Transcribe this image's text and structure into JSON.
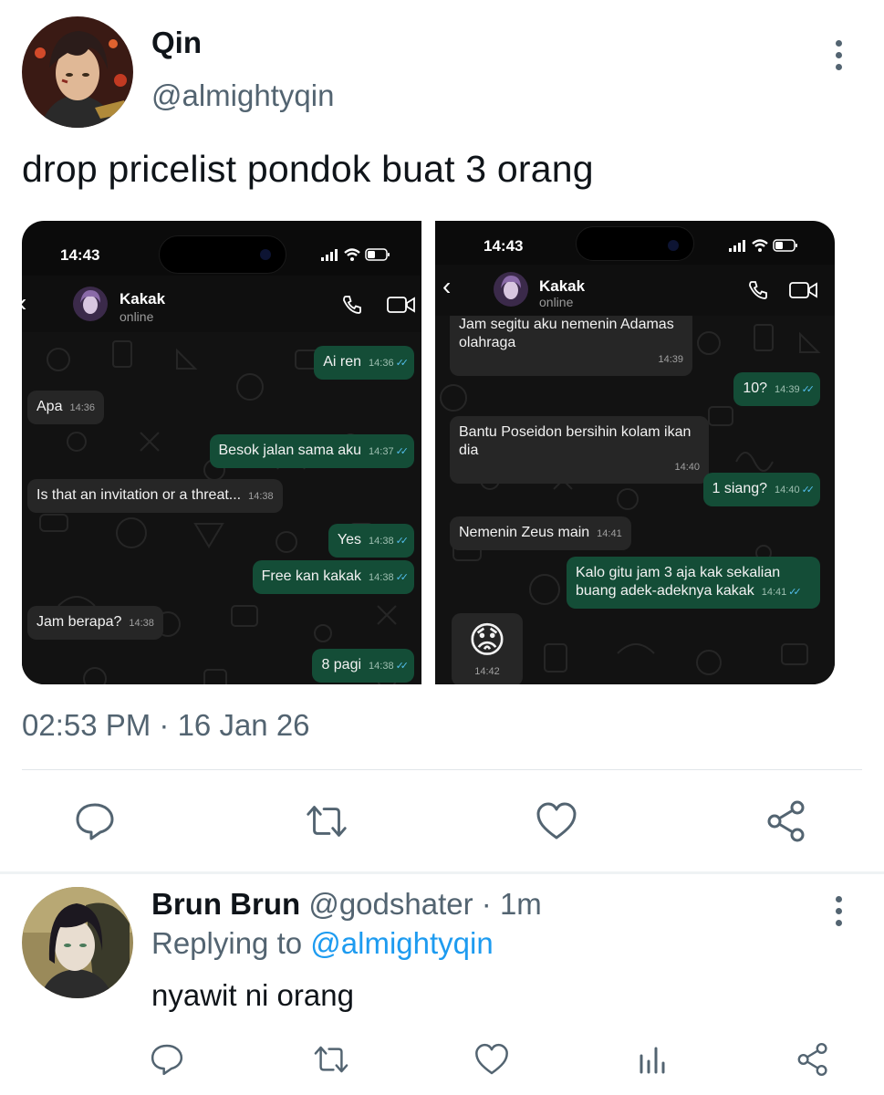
{
  "tweet": {
    "author_name": "Qin",
    "author_handle": "@almightyqin",
    "text": "drop pricelist pondok buat 3 orang",
    "timestamp": "02:53 PM · 16 Jan 26"
  },
  "screenshot_left": {
    "status_time": "14:43",
    "contact_name": "Kakak",
    "contact_status": "online",
    "messages": [
      {
        "dir": "out",
        "text": "Ai ren",
        "time": "14:36"
      },
      {
        "dir": "in",
        "text": "Apa",
        "time": "14:36"
      },
      {
        "dir": "out",
        "text": "Besok jalan sama aku",
        "time": "14:37"
      },
      {
        "dir": "in",
        "text": "Is that an invitation or a threat...",
        "time": "14:38"
      },
      {
        "dir": "out",
        "text": "Yes",
        "time": "14:38"
      },
      {
        "dir": "out",
        "text": "Free kan kakak",
        "time": "14:38"
      },
      {
        "dir": "in",
        "text": "Jam berapa?",
        "time": "14:38"
      },
      {
        "dir": "out",
        "text": "8 pagi",
        "time": "14:38"
      }
    ]
  },
  "screenshot_right": {
    "status_time": "14:43",
    "contact_name": "Kakak",
    "contact_status": "online",
    "messages": [
      {
        "dir": "in",
        "text": "Jam segitu aku nemenin Adamas olahraga",
        "time": "14:39"
      },
      {
        "dir": "out",
        "text": "10?",
        "time": "14:39"
      },
      {
        "dir": "in",
        "text": "Bantu Poseidon bersihin kolam ikan dia",
        "time": "14:40"
      },
      {
        "dir": "out",
        "text": "1 siang?",
        "time": "14:40"
      },
      {
        "dir": "in",
        "text": "Nemenin Zeus main",
        "time": "14:41"
      },
      {
        "dir": "out",
        "text": "Kalo gitu jam 3 aja kak sekalian buang adek-adeknya kakak",
        "time": "14:41"
      },
      {
        "dir": "in",
        "text": "😟",
        "time": "14:42"
      }
    ]
  },
  "reply": {
    "author_name": "Brun Brun",
    "author_handle": "@godshater",
    "age": "1m",
    "replying_prefix": "Replying to",
    "replying_to": "@almightyqin",
    "text": "nyawit ni orang"
  },
  "colors": {
    "text_primary": "#0f1419",
    "text_secondary": "#536471",
    "link": "#1d9bf0",
    "bubble_out": "#144d37",
    "bubble_in": "#262626"
  },
  "icons": [
    "more-vertical-icon",
    "reply-icon",
    "retweet-icon",
    "like-icon",
    "share-icon",
    "analytics-icon",
    "phone-icon",
    "video-icon",
    "back-chevron-icon",
    "signal-icon",
    "wifi-icon",
    "battery-icon"
  ]
}
